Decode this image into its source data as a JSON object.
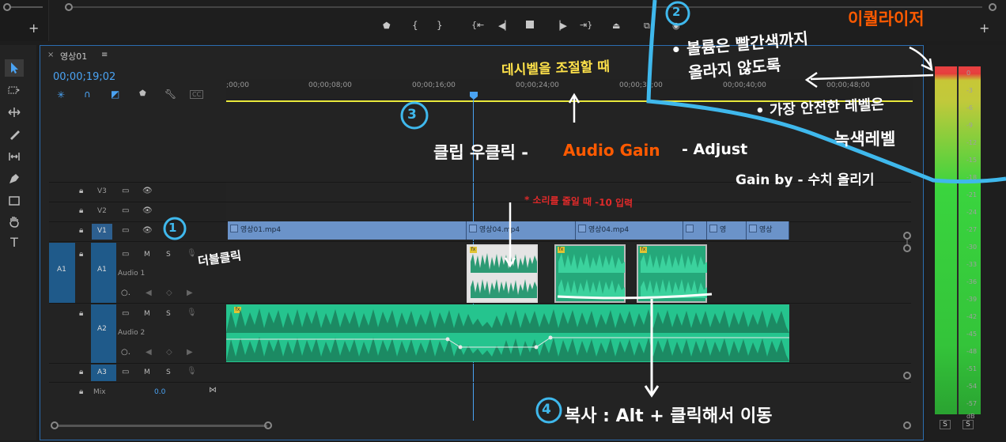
{
  "sequence": {
    "tab_name": "영상01",
    "close_label": "×",
    "menu_label": "≡",
    "timecode": "00;00;19;02"
  },
  "ruler": {
    "ticks": [
      ";00;00",
      "00;00;08;00",
      "00;00;16;00",
      "00;00;24;00",
      "00;00;32;00",
      "00;00;40;00",
      "00;00;48;00"
    ]
  },
  "tracks": {
    "v3": {
      "name": "V3"
    },
    "v2": {
      "name": "V2"
    },
    "v1": {
      "name": "V1"
    },
    "a1": {
      "name": "A1",
      "src": "A1",
      "label": "Audio 1",
      "m": "M",
      "s": "S"
    },
    "a2": {
      "name": "A2",
      "label": "Audio 2",
      "m": "M",
      "s": "S"
    },
    "a3": {
      "name": "A3",
      "m": "M",
      "s": "S"
    },
    "mix": {
      "name": "Mix",
      "value": "0.0"
    }
  },
  "clips": {
    "v1": [
      "영상01.mp4",
      "영상04.mp4",
      "영상04.mp4",
      "",
      "영",
      "영상"
    ]
  },
  "meter": {
    "scale": [
      "0",
      "-3",
      "-6",
      "-9",
      "-12",
      "-15",
      "-18",
      "-21",
      "-24",
      "-27",
      "-30",
      "-33",
      "-36",
      "-39",
      "-42",
      "-45",
      "-48",
      "-51",
      "-54",
      "-57",
      "dB"
    ],
    "solo_left": "S",
    "solo_right": "S"
  },
  "annotations": {
    "circle1": "1",
    "circle2": "2",
    "circle3": "3",
    "circle4": "4",
    "double_click": "더블클릭",
    "decibel_control": "데시벨을 조절할 때",
    "right_click": "클립 우클릭 -",
    "audio_gain": "Audio Gain",
    "adjust": "- Adjust",
    "gain_by": "Gain by - 수치 올리기",
    "reduce_note": "* 소리를 줄일 때 -10 입력",
    "equalizer": "이퀄라이저",
    "volume_line1": "• 볼륨은 빨간색까지",
    "volume_line2": "올라지 않도록",
    "safe_line1": "• 가장 안전한 레벨은",
    "safe_line2": "녹색레벨",
    "copy": "복사 : Alt + 클릭해서 이동"
  },
  "colors": {
    "accent_blue": "#2b6db0",
    "timecode_blue": "#4aa3f3",
    "video_clip": "#6b93c9",
    "audio_wave": "#25c48e",
    "work_area": "#e9e93b",
    "annotation_orange": "#ff5a00",
    "annotation_yellow": "#ffe24a",
    "annotation_cyan": "#3fb8ec",
    "annotation_red": "#e02a2a"
  }
}
